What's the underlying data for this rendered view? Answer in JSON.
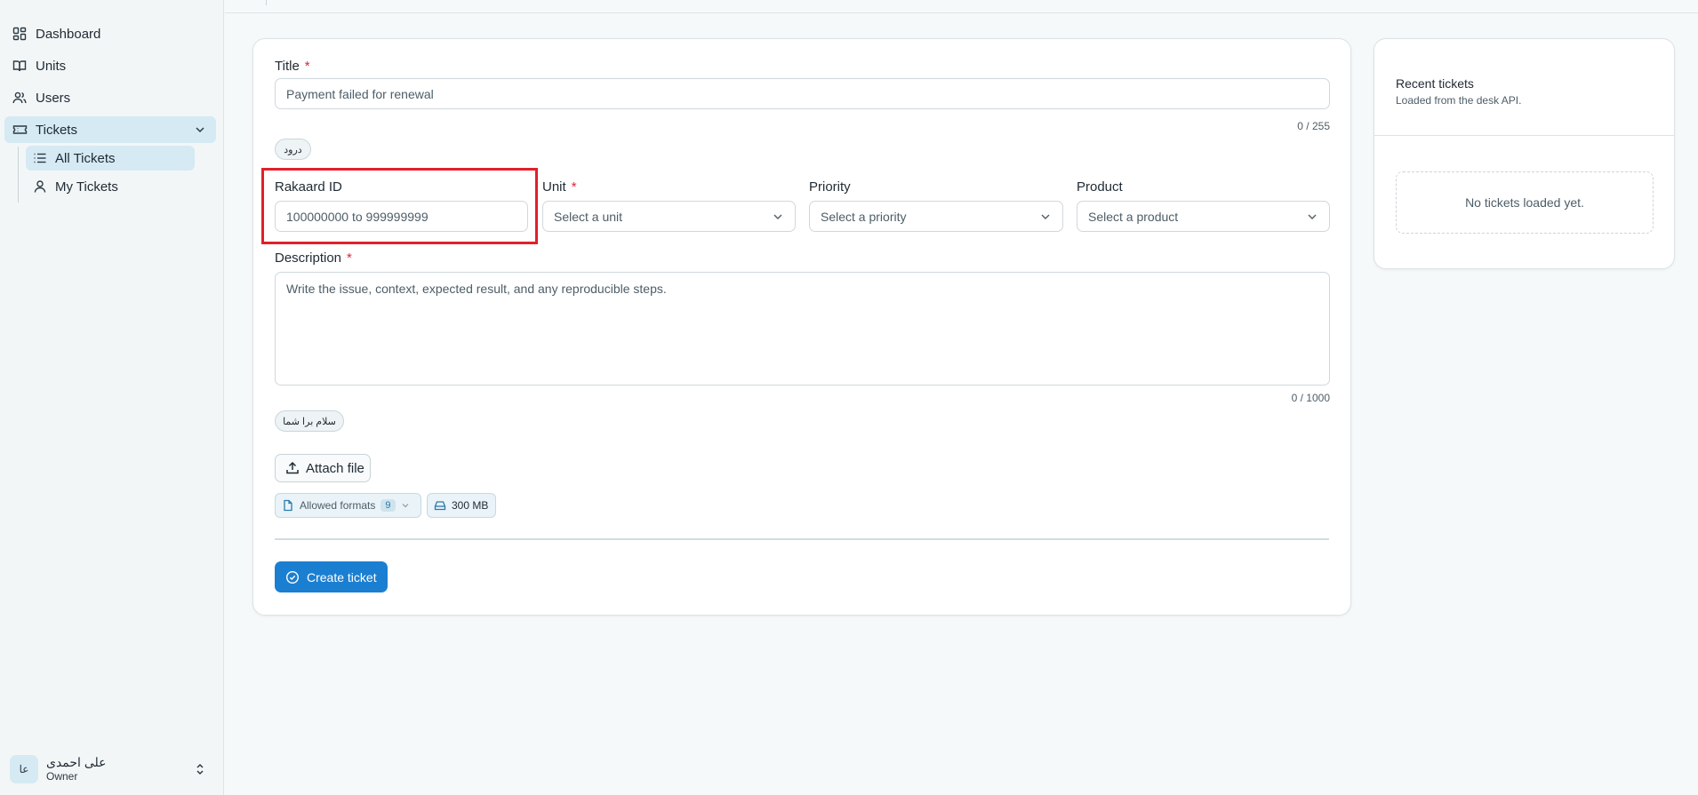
{
  "sidebar": {
    "items": [
      {
        "label": "Dashboard",
        "icon": "dashboard-icon"
      },
      {
        "label": "Units",
        "icon": "book-icon"
      },
      {
        "label": "Users",
        "icon": "users-icon"
      },
      {
        "label": "Tickets",
        "icon": "ticket-icon"
      }
    ],
    "sub_items": [
      {
        "label": "All Tickets",
        "icon": "list-icon"
      },
      {
        "label": "My Tickets",
        "icon": "user-icon"
      }
    ],
    "user": {
      "avatar_text": "عا",
      "name": "علی احمدی",
      "role": "Owner"
    }
  },
  "form": {
    "title_label": "Title",
    "title_value": "Payment failed for renewal",
    "title_counter": "0 / 255",
    "title_chip": "درود",
    "rakaard_label": "Rakaard ID",
    "rakaard_placeholder": "100000000 to 999999999",
    "unit_label": "Unit",
    "unit_placeholder": "Select a unit",
    "priority_label": "Priority",
    "priority_placeholder": "Select a priority",
    "product_label": "Product",
    "product_placeholder": "Select a product",
    "description_label": "Description",
    "description_placeholder": "Write the issue, context, expected result, and any reproducible steps.",
    "description_counter": "0 / 1000",
    "description_chip": "سلام برا شما",
    "required_mark": "*",
    "attach_label": "Attach file",
    "allowed_formats_label": "Allowed formats",
    "allowed_formats_count": "9",
    "max_size_label": "300 MB",
    "create_label": "Create ticket"
  },
  "recent": {
    "title": "Recent tickets",
    "subtitle": "Loaded from the desk API.",
    "empty": "No tickets loaded yet."
  },
  "colors": {
    "accent": "#1b7fd1",
    "active_nav": "#d5eaf3",
    "required": "#e0243a",
    "highlight": "#e0202a"
  }
}
